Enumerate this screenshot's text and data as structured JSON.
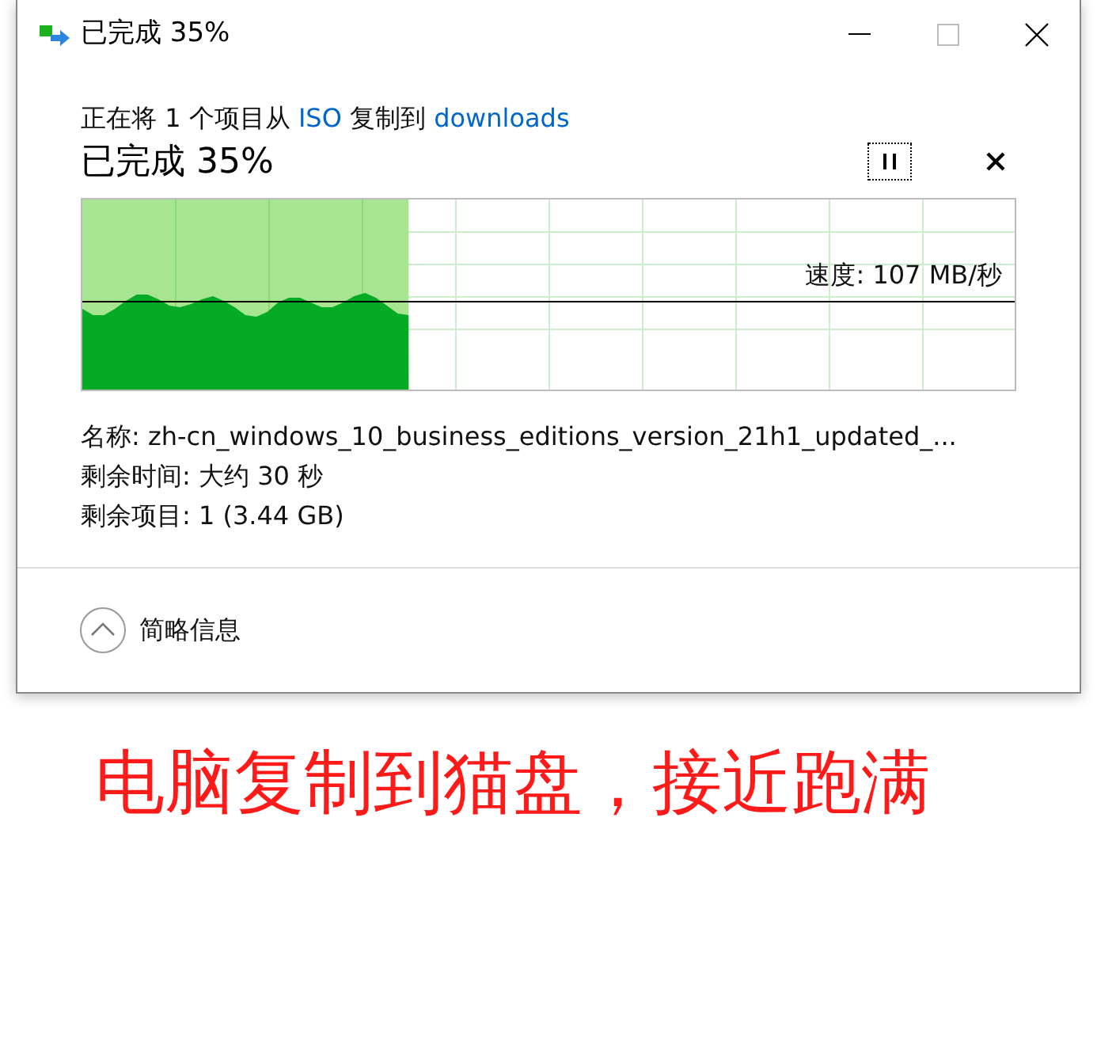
{
  "window": {
    "title": "已完成 35%"
  },
  "header": {
    "prefix": "正在将 1 个项目从 ",
    "source": "ISO",
    "middle": " 复制到 ",
    "destination": "downloads"
  },
  "status": "已完成 35%",
  "progress": {
    "level": 0.35,
    "speed": "速度: 107 MB/秒"
  },
  "details": [
    "名称: zh-cn_windows_10_business_editions_version_21h1_updated_...",
    "剩余时间: 大约 30 秒",
    "剩余项目: 1 (3.44 GB)"
  ],
  "toggle": {
    "label": "简略信息",
    "expanded": true
  },
  "caption": "电脑复制到猫盘，接近跑满"
}
